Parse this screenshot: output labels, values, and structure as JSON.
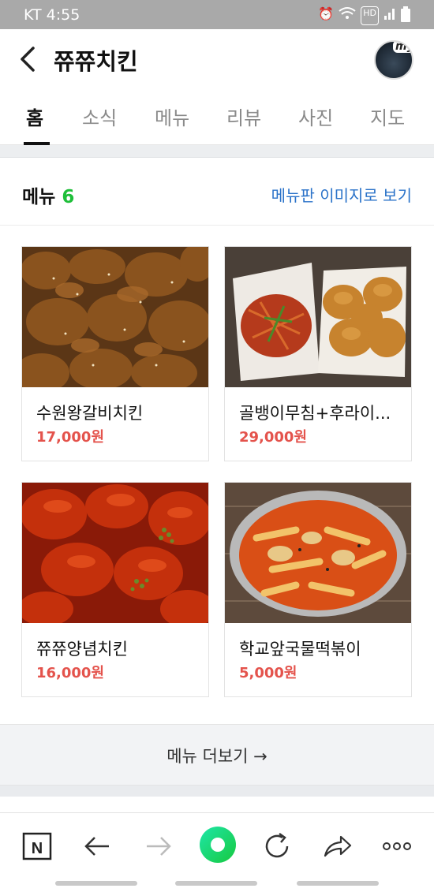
{
  "status": {
    "time": "KT 4:55",
    "icons": [
      "alarm-icon",
      "wifi-icon",
      "hd-icon",
      "signal-icon",
      "battery-icon"
    ]
  },
  "header": {
    "title": "쮸쮸치킨",
    "avatar_badge": "my"
  },
  "tabs": [
    {
      "label": "홈",
      "active": true
    },
    {
      "label": "소식",
      "active": false
    },
    {
      "label": "메뉴",
      "active": false
    },
    {
      "label": "리뷰",
      "active": false
    },
    {
      "label": "사진",
      "active": false
    },
    {
      "label": "지도",
      "active": false
    }
  ],
  "menu": {
    "heading": "메뉴",
    "count": "6",
    "image_link": "메뉴판 이미지로 보기",
    "items": [
      {
        "name": "수원왕갈비치킨",
        "price": "17,000원"
      },
      {
        "name": "골뱅이무침+후라이...",
        "price": "29,000원"
      },
      {
        "name": "쮸쮸양념치킨",
        "price": "16,000원"
      },
      {
        "name": "학교앞국물떡볶이",
        "price": "5,000원"
      }
    ],
    "more_label": "메뉴 더보기 →"
  },
  "bottom_nav": {
    "icons": [
      "naver-n-icon",
      "back-arrow-icon",
      "forward-arrow-icon",
      "green-dot-icon",
      "reload-icon",
      "share-icon",
      "more-dots-icon"
    ]
  },
  "colors": {
    "accent_green": "#1fbf3a",
    "price_red": "#e4534c",
    "link_blue": "#2b73c9"
  }
}
